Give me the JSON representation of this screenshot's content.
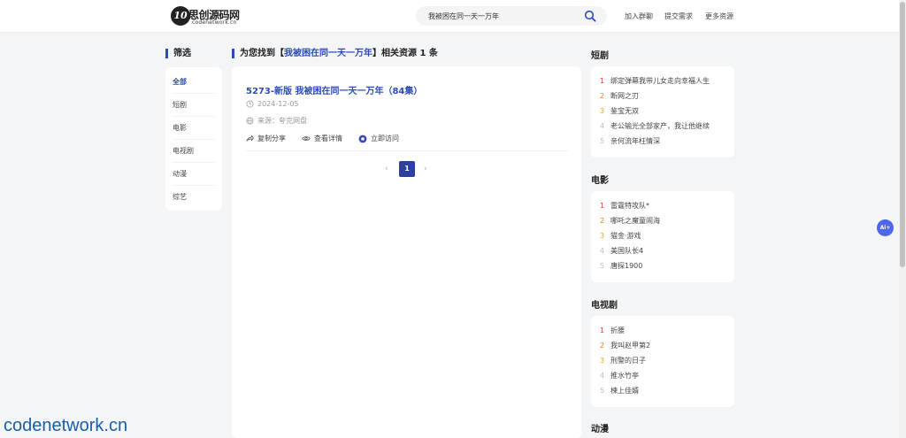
{
  "header": {
    "logo_mark": "10",
    "logo_name": "思创源码网",
    "logo_domain": "codenetwork.cn",
    "search_value": "我被困在同一天一万年",
    "nav": [
      "加入群聊",
      "提交需求",
      "更多资源"
    ]
  },
  "filter": {
    "title": "筛选",
    "items": [
      "全部",
      "短剧",
      "电影",
      "电视剧",
      "动漫",
      "综艺"
    ]
  },
  "results": {
    "title_prefix": "为您找到【",
    "keyword": "我被困在同一天一万年",
    "title_suffix": "】相关资源 1 条",
    "item": {
      "name": "5273-新版 我被困在同一天一万年（84集）",
      "date": "2024-12-05",
      "source": "来源：夸克网盘",
      "actions": [
        "复制分享",
        "查看详情",
        "立即访问"
      ]
    },
    "pager": {
      "prev": "‹",
      "current": "1",
      "next": "›"
    }
  },
  "sidebar_right": [
    {
      "title": "短剧",
      "items": [
        "绑定弹幕我带儿女走向幸福人生",
        "断网之刃",
        "鉴宝无双",
        "老公输光全部家产，我让他继续",
        "亲何流年枉情深"
      ]
    },
    {
      "title": "电影",
      "items": [
        "雷霆特攻队*",
        "哪吒之魔童闹海",
        "猫金·游戏",
        "美国队长4",
        "唐探1900"
      ]
    },
    {
      "title": "电视剧",
      "items": [
        "折腰",
        "我叫赵甲第2",
        "刑警的日子",
        "推水竹亭",
        "楝上佳婿"
      ]
    },
    {
      "title": "动漫",
      "items": []
    }
  ],
  "rank_numbers": [
    "1",
    "2",
    "3",
    "4",
    "5"
  ],
  "ai_button": "Ai+",
  "watermark": "codenetwork.cn",
  "colors": {
    "accent": "#2d4bb8",
    "rank1": "#e0383e",
    "rank2": "#f07a22",
    "rank3": "#e0a81e"
  }
}
